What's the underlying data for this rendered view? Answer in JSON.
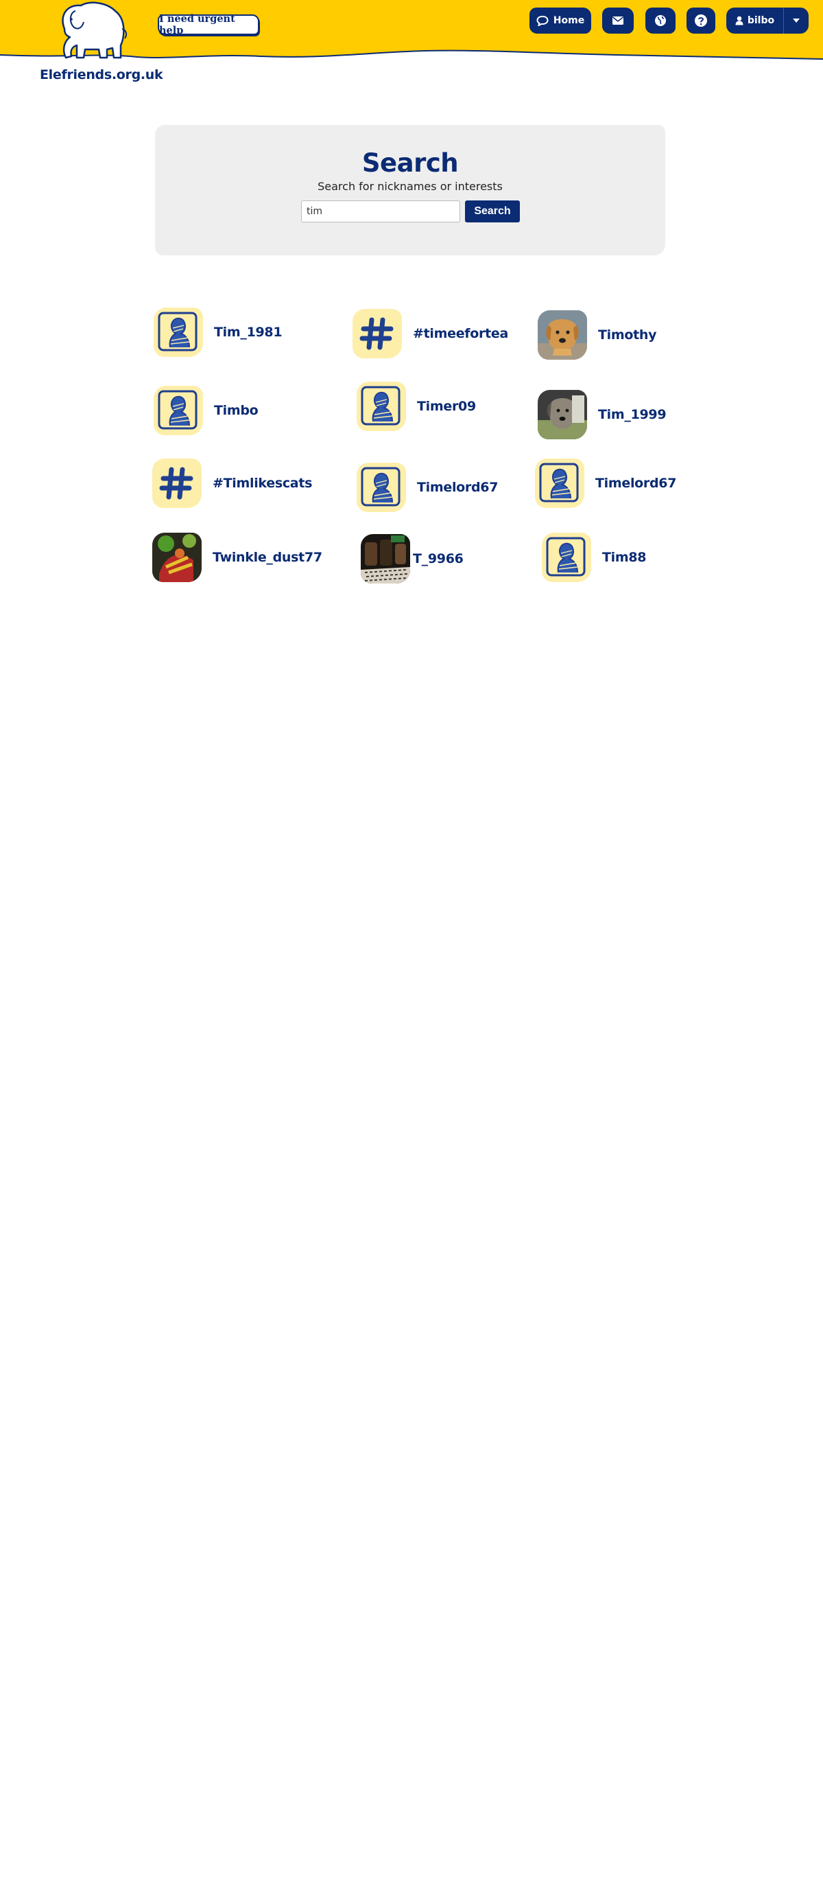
{
  "header": {
    "site_name": "Elefriends.org.uk",
    "urgent_help_label": "I need urgent help",
    "nav": {
      "home_label": "Home",
      "user_label": "bilbo"
    },
    "colors": {
      "brand_yellow": "#ffcc00",
      "brand_navy": "#0b2b73"
    }
  },
  "search": {
    "title": "Search",
    "subtitle": "Search for nicknames or interests",
    "input_value": "tim",
    "button_label": "Search"
  },
  "results": [
    {
      "name": "Tim_1981",
      "avatar": "default-avatar"
    },
    {
      "name": "#timeefortea",
      "avatar": "hashtag"
    },
    {
      "name": "Timothy",
      "avatar": "photo-dog"
    },
    {
      "name": "Timbo",
      "avatar": "default-avatar"
    },
    {
      "name": "Timer09",
      "avatar": "default-avatar"
    },
    {
      "name": "Tim_1999",
      "avatar": "photo-dog-grey"
    },
    {
      "name": "#Timlikescats",
      "avatar": "hashtag"
    },
    {
      "name": "Timelord67",
      "avatar": "default-avatar"
    },
    {
      "name": "Timelord67",
      "avatar": "default-avatar"
    },
    {
      "name": "Twinkle_dust77",
      "avatar": "photo-colourful"
    },
    {
      "name": "T_9966",
      "avatar": "photo-dark"
    },
    {
      "name": "Tim88",
      "avatar": "default-avatar"
    }
  ]
}
